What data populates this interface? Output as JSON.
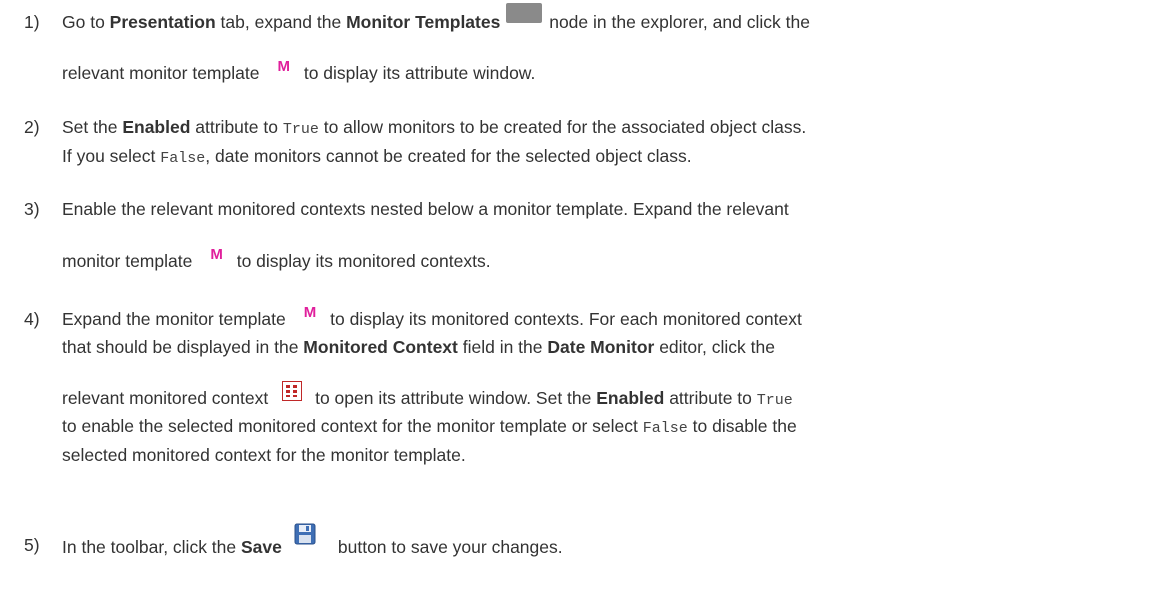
{
  "steps": [
    {
      "num": "1)",
      "l1_a": "Go to ",
      "l1_b": "Presentation",
      "l1_c": " tab, expand the ",
      "l1_d": "Monitor Templates",
      "l1_e": " node in the explorer, and click the",
      "l2_a": "relevant monitor template",
      "l2_b": " to display its attribute window.",
      "icon_folder": "folder-icon",
      "icon_m": "M"
    },
    {
      "num": "2)",
      "l1_a": "Set the ",
      "l1_b": "Enabled",
      "l1_c": " attribute to ",
      "l1_code": "True",
      "l1_d": " to allow monitors to be created for the associated object class.",
      "l2_a": "If you select ",
      "l2_code": "False",
      "l2_b": ", date monitors cannot be created for the selected object class."
    },
    {
      "num": "3)",
      "l1": "Enable the relevant monitored contexts nested below a monitor template. Expand the relevant",
      "l2_a": "monitor template",
      "l2_b": " to display its monitored contexts.",
      "icon_m": "M"
    },
    {
      "num": "4)",
      "l1_a": "Expand the monitor template",
      "l1_b": " to display its monitored contexts. For each monitored context",
      "l2_a": "that should be displayed in the ",
      "l2_b": "Monitored Context",
      "l2_c": " field in the ",
      "l2_d": "Date Monitor",
      "l2_e": " editor, click the",
      "l3_a": "relevant monitored context",
      "l3_b": " to open its attribute window. Set the ",
      "l3_c": "Enabled",
      "l3_d": " attribute to ",
      "l3_code": "True",
      "l4_a": "to enable the selected monitored context for the monitor template or select ",
      "l4_code": "False",
      "l4_b": " to disable the",
      "l5": "selected monitored context for the monitor template.",
      "icon_m": "M"
    },
    {
      "num": "5)",
      "l1_a": "In the toolbar, click the ",
      "l1_b": "Save",
      "l1_c": "button to save your changes."
    }
  ],
  "colors": {
    "text": "#333333",
    "m_icon": "#e01f9c",
    "grid_icon": "#c02828",
    "folder_icon": "#8a8a8a"
  }
}
